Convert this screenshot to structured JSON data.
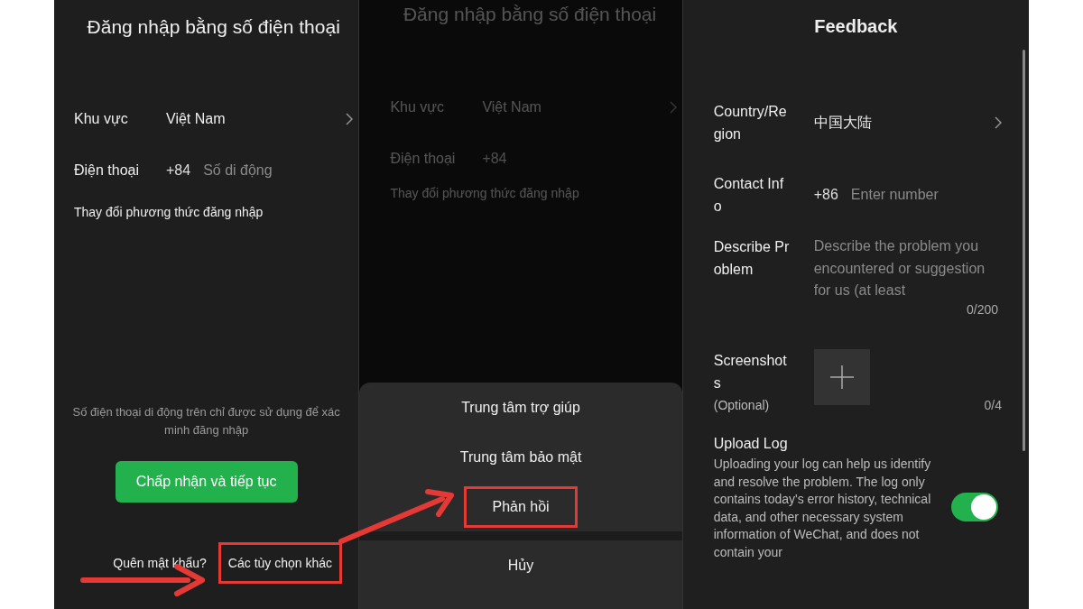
{
  "login_screen": {
    "title": "Đăng nhập bằng số điện thoại",
    "region": {
      "label": "Khu vực",
      "value": "Việt Nam"
    },
    "phone": {
      "label": "Điện thoại",
      "prefix": "+84",
      "placeholder": "Số di động"
    },
    "switch_method": "Thay đổi phương thức đăng nhập",
    "note": "Số điện thoại di động trên chỉ được sử dụng để xác minh đăng nhập",
    "accept_button": "Chấp nhận và tiếp tục",
    "links": [
      {
        "label": "Quên mật khẩu?",
        "highlighted": false
      },
      {
        "label": "Các tùy chọn khác",
        "highlighted": true
      }
    ]
  },
  "options_screen": {
    "background": {
      "title": "Đăng nhập bằng số điện thoại",
      "region_label": "Khu vực",
      "region_value": "Việt Nam",
      "phone_label": "Điện thoại",
      "phone_prefix": "+84",
      "switch_method": "Thay đổi phương thức đăng nhập"
    },
    "menu": [
      {
        "label": "Trung tâm trợ giúp",
        "highlighted": false
      },
      {
        "label": "Trung tâm bảo mật",
        "highlighted": false
      },
      {
        "label": "Phản hồi",
        "highlighted": true
      }
    ],
    "cancel": "Hủy"
  },
  "feedback_screen": {
    "title": "Feedback",
    "country": {
      "label": "Country/Region",
      "value": "中国大陆"
    },
    "contact": {
      "label": "Contact Info",
      "prefix": "+86",
      "placeholder": "Enter number"
    },
    "describe": {
      "label": "Describe Problem",
      "placeholder": "Describe the problem you encountered or suggestion for us (at least",
      "counter": "0/200"
    },
    "screenshots": {
      "label": "Screenshots",
      "hint": "(Optional)",
      "counter": "0/4"
    },
    "upload_log": {
      "title": "Upload Log",
      "description": "Uploading your log can help us identify and resolve the problem. The log only contains today's error history, technical data, and other necessary system information of WeChat, and does not contain your",
      "on": true
    }
  }
}
